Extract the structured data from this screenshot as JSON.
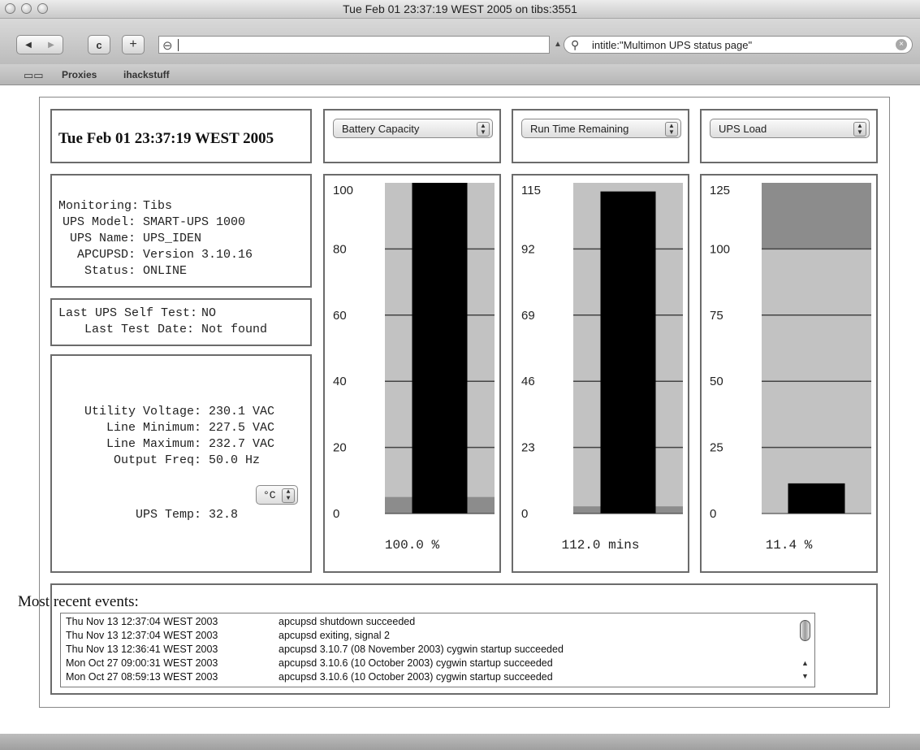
{
  "window": {
    "title": "Tue Feb 01 23:37:19 WEST 2005 on tibs:3551"
  },
  "toolbar": {
    "back_glyph": "◀",
    "forward_glyph": "▶",
    "reload_glyph": "c",
    "add_glyph": "+",
    "site_glyph": "⊖",
    "url_value": "",
    "search_query": "intitle:\"Multimon UPS status page\""
  },
  "bookmarks": {
    "items": [
      "Proxies",
      "ihackstuff"
    ]
  },
  "page": {
    "datetime": "Tue Feb 01 23:37:19 WEST 2005",
    "monitoring": [
      {
        "key": "Monitoring:",
        "value": "Tibs"
      },
      {
        "key": "UPS Model:",
        "value": "SMART-UPS 1000"
      },
      {
        "key": "UPS Name:",
        "value": "UPS_IDEN"
      },
      {
        "key": "APCUPSD:",
        "value": "Version 3.10.16"
      },
      {
        "key": "Status:",
        "value": "ONLINE"
      }
    ],
    "selftest": [
      {
        "key": "Last UPS Self Test:",
        "value": "NO"
      },
      {
        "key": "Last Test Date:",
        "value": "Not found"
      }
    ],
    "power": [
      {
        "key": "Utility Voltage:",
        "value": "230.1 VAC"
      },
      {
        "key": "Line Minimum:",
        "value": "227.5 VAC"
      },
      {
        "key": "Line Maximum:",
        "value": "232.7 VAC"
      },
      {
        "key": "Output Freq:",
        "value": "50.0 Hz"
      }
    ],
    "temp_unit": "°C",
    "temp": {
      "key": "UPS Temp:",
      "value": "32.8"
    },
    "events_title": "Most recent events:",
    "events": [
      {
        "time": "Thu Nov 13 12:37:04 WEST 2003",
        "msg": "apcupsd shutdown succeeded"
      },
      {
        "time": "Thu Nov 13 12:37:04 WEST 2003",
        "msg": "apcupsd exiting, signal 2"
      },
      {
        "time": "Thu Nov 13 12:36:41 WEST 2003",
        "msg": "apcupsd 3.10.7 (08 November 2003) cygwin startup succeeded"
      },
      {
        "time": "Mon Oct 27 09:00:31 WEST 2003",
        "msg": "apcupsd 3.10.6 (10 October 2003) cygwin startup succeeded"
      },
      {
        "time": "Mon Oct 27 08:59:13 WEST 2003",
        "msg": "apcupsd 3.10.6 (10 October 2003) cygwin startup succeeded"
      }
    ]
  },
  "colors": {
    "gauge_bg": "#c2c2c2",
    "gauge_bar": "#000000",
    "gauge_band": "#8c8c8c",
    "gauge_line": "#444444"
  },
  "chart_data": [
    {
      "type": "bar",
      "title": "Battery Capacity",
      "ticks": [
        "0",
        "20",
        "40",
        "60",
        "80",
        "100"
      ],
      "ylim": [
        0,
        100
      ],
      "value": 100.0,
      "reading": "100.0 %",
      "band": {
        "from": 0,
        "to": 5
      }
    },
    {
      "type": "bar",
      "title": "Run Time Remaining",
      "ticks": [
        "0",
        "23",
        "46",
        "69",
        "92",
        "115"
      ],
      "ylim": [
        0,
        115
      ],
      "value": 112.0,
      "reading": "112.0 mins",
      "band": {
        "from": 0,
        "to": 2.5
      }
    },
    {
      "type": "bar",
      "title": "UPS Load",
      "ticks": [
        "0",
        "25",
        "50",
        "75",
        "100",
        "125"
      ],
      "ylim": [
        0,
        125
      ],
      "value": 11.4,
      "reading": "11.4 %",
      "band": {
        "from": 100,
        "to": 125
      }
    }
  ]
}
